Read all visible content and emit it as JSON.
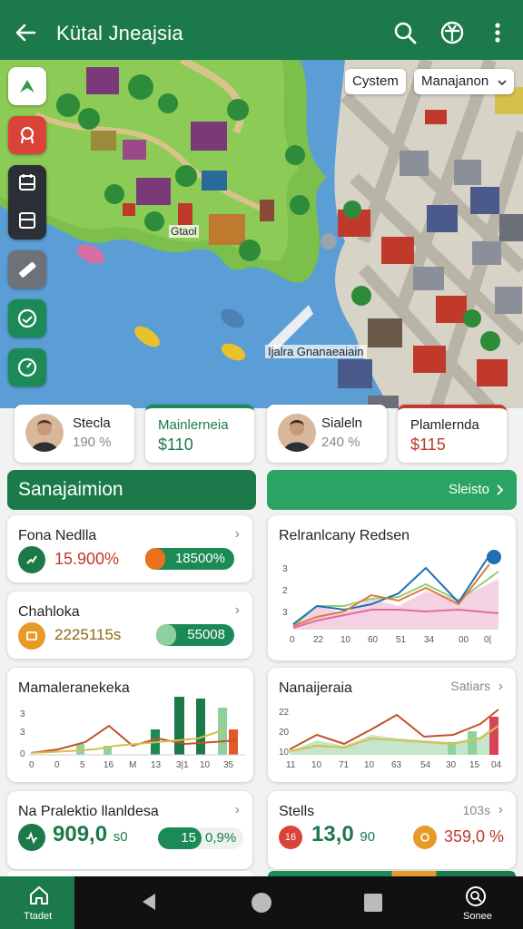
{
  "app": {
    "title": "Kütal Jneajsia"
  },
  "map": {
    "chips": [
      "Cystem",
      "Manajanon"
    ],
    "place_labels": [
      "Gtaol",
      "Ijalra Gnanaeaiain"
    ]
  },
  "people": [
    {
      "name": "Stecla",
      "value": "190 %"
    },
    {
      "label": "Mainlerneia",
      "amount": "$110"
    },
    {
      "name": "Sialeln",
      "value": "240 %"
    },
    {
      "label": "Plamlernda",
      "amount": "$115"
    }
  ],
  "sections": {
    "left": "Sanajaimion",
    "right": "Sleisto"
  },
  "cards": {
    "fona": {
      "title": "Fona Nedlla",
      "value": "15.900%",
      "pill": "18500%"
    },
    "chahloka": {
      "title": "Chahloka",
      "value": "2225115s",
      "pill": "55008"
    },
    "relranlcany": {
      "title": "Relranlcany Redsen",
      "yticks": [
        "3",
        "2",
        "3"
      ],
      "xticks": [
        "0",
        "22",
        "10",
        "60",
        "51",
        "34",
        "00",
        "0|"
      ]
    },
    "mamaler": {
      "title": "Mamaleranekeka",
      "yticks": [
        "3",
        "3",
        "0"
      ],
      "xticks": [
        "0",
        "0",
        "5",
        "16",
        "M",
        "13",
        "3|1",
        "10",
        "35"
      ]
    },
    "nanaij": {
      "title": "Nanaijeraia",
      "chev_text": "Satiars",
      "yticks": [
        "22",
        "20",
        "10"
      ],
      "xticks": [
        "11",
        "10",
        "71",
        "10",
        "63",
        "54",
        "30",
        "15",
        "04"
      ]
    },
    "naprak": {
      "title": "Na Pralektio llanldesa",
      "value": "909,0",
      "unit": "s0",
      "pill_num": "15",
      "pill_pct": "0,9%"
    },
    "stells": {
      "title": "Stells",
      "chev_text": "103s",
      "badge": "16",
      "value": "13,0",
      "unit": "90",
      "pct": "359,0 %"
    }
  },
  "bottom_nav": {
    "home": "Ttadet",
    "right": "Sonee"
  },
  "colors": {
    "primary": "#1c7a4a",
    "accent_red": "#c0392b",
    "accent_orange": "#e67e22"
  }
}
